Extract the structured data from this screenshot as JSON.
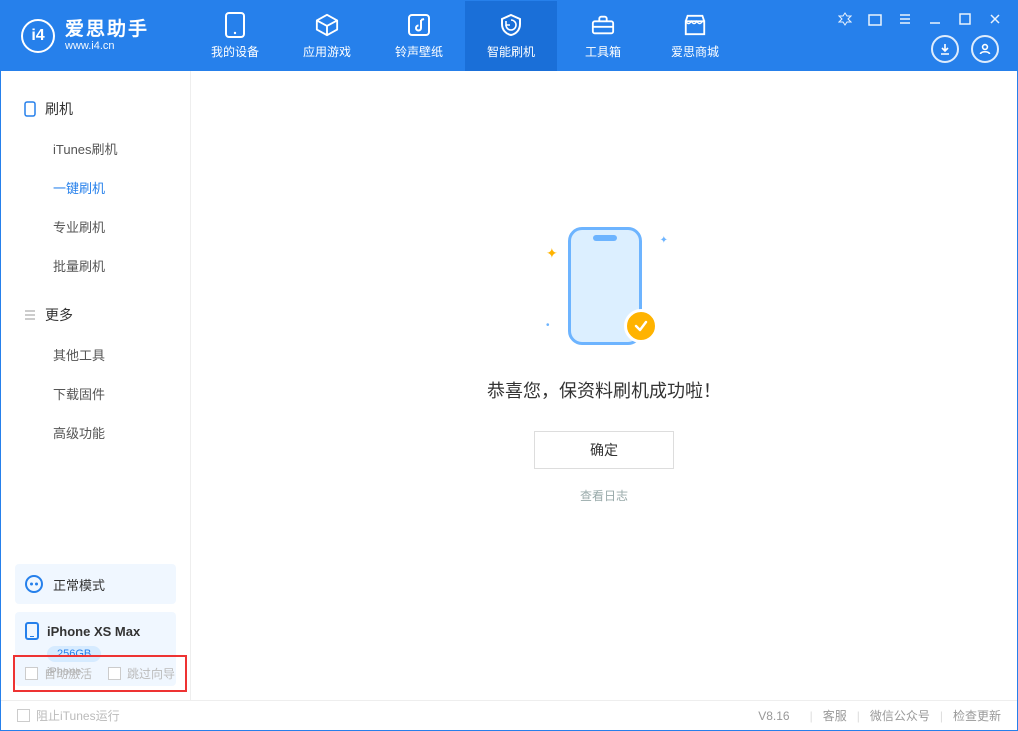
{
  "app": {
    "name": "爱思助手",
    "url": "www.i4.cn"
  },
  "topnav": {
    "items": [
      {
        "label": "我的设备",
        "icon": "device-icon"
      },
      {
        "label": "应用游戏",
        "icon": "box-icon"
      },
      {
        "label": "铃声壁纸",
        "icon": "music-icon"
      },
      {
        "label": "智能刷机",
        "icon": "shield-icon"
      },
      {
        "label": "工具箱",
        "icon": "toolbox-icon"
      },
      {
        "label": "爱思商城",
        "icon": "store-icon"
      }
    ],
    "active_index": 3
  },
  "sidebar": {
    "section1": {
      "title": "刷机",
      "items": [
        "iTunes刷机",
        "一键刷机",
        "专业刷机",
        "批量刷机"
      ],
      "active_index": 1
    },
    "section2": {
      "title": "更多",
      "items": [
        "其他工具",
        "下载固件",
        "高级功能"
      ]
    }
  },
  "device": {
    "mode": "正常模式",
    "name": "iPhone XS Max",
    "storage": "256GB",
    "type": "iPhone"
  },
  "main": {
    "title": "恭喜您，保资料刷机成功啦！",
    "ok": "确定",
    "log": "查看日志"
  },
  "bottombox": {
    "chk1": "自动激活",
    "chk2": "跳过向导"
  },
  "statusbar": {
    "block_itunes": "阻止iTunes运行",
    "version": "V8.16",
    "links": [
      "客服",
      "微信公众号",
      "检查更新"
    ]
  }
}
